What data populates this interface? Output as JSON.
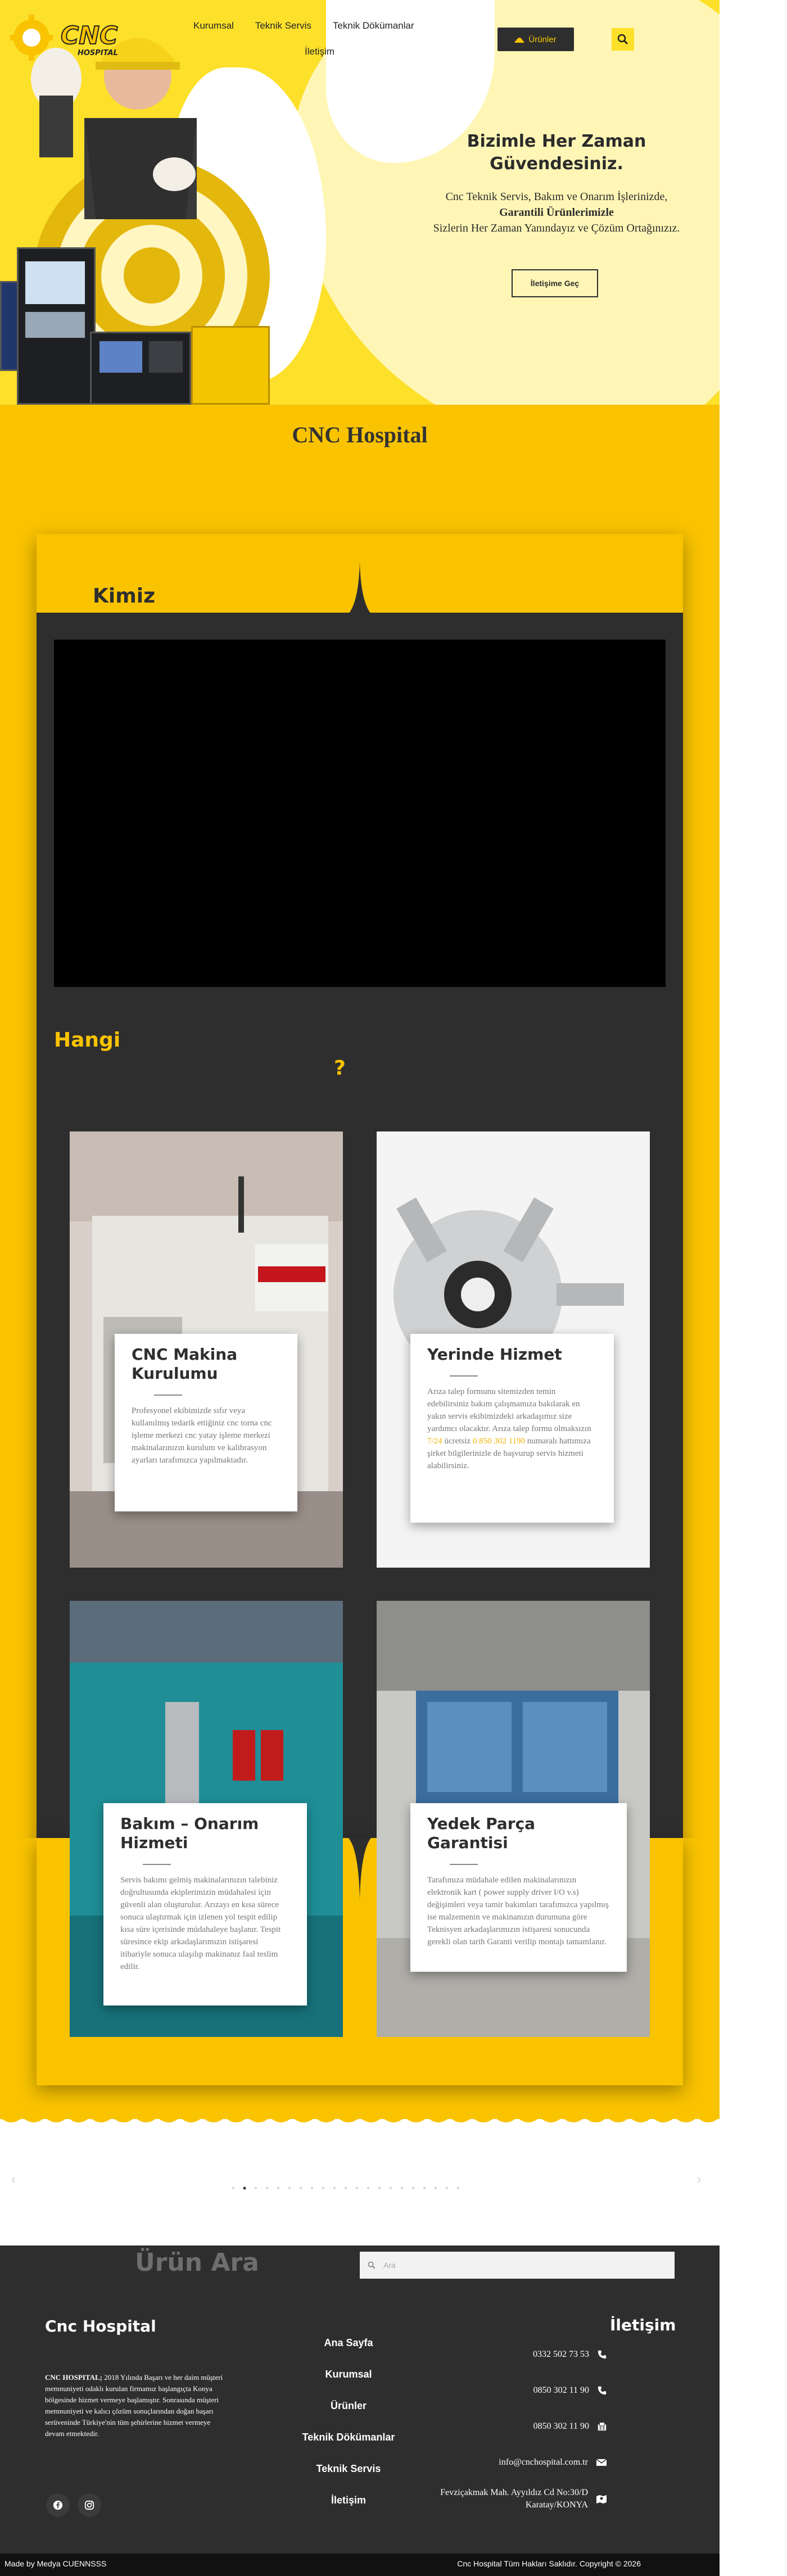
{
  "brand": {
    "logo_main": "CNC",
    "logo_sub": "HOSPITAL"
  },
  "nav": {
    "items": [
      "Kurumsal",
      "Teknik Servis",
      "Teknik Dökümanlar"
    ],
    "second_row": "İletişim",
    "products_button": "Ürünler"
  },
  "hero": {
    "title": "Bizimle Her Zaman Güvendesiniz.",
    "text_before": "Cnc Teknik Servis, Bakım ve Onarım İşlerinizde,",
    "text_bold": "Garantili Ürünlerimizle",
    "text_after": "Sizlerin Her Zaman Yanındayız ve Çözüm Ortağınızız.",
    "cta": "İletişime Geç"
  },
  "band": {
    "title": "CNC Hospital"
  },
  "about": {
    "heading": "Kimiz"
  },
  "services_heading": {
    "word": "Hangi",
    "qmark": "?"
  },
  "services": [
    {
      "title": "CNC Makina Kurulumu",
      "desc": "Profesyonel ekibimizde sıfır veya kullanılmış tedarik ettiğiniz cnc torna cnc işleme merkezi cnc yatay işleme merkezi makinalarınızın kurulum ve kalibrasyon ayarları tarafımızca yapılmaktadır."
    },
    {
      "title": "Yerinde Hizmet",
      "desc_1": "Arıza talep formunu sitemizden temin edebilirsiniz bakım çalışmamıza bakılarak en yakın servis ekibimizdeki arkadaşımız size yardımcı olacaktır. Arıza talep formu olmaksızın ",
      "desc_hl_1": "7/24",
      "desc_2": " ücretsiz ",
      "desc_hl_2": "0 850 302 1190",
      "desc_3": " numaralı hattımıza şirket bilgilerinizle de başvurup servis hizmeti alabilirsiniz."
    },
    {
      "title": "Bakım – Onarım Hizmeti",
      "desc": "Servis bakımı gelmiş makinalarınızın talebiniz doğrultusunda ekiplerimizin müdahalesi için güvenli alan oluşturulur. Arızayı en kısa sürece sonuca ulaştırmak için izlenen yol tespit edilip kısa süre içerisinde müdahaleye başlanır. Tespit süresince ekip arkadaşlarımızın istişaresi itibariyle sonuca ulaşılıp makinanız faal teslim edilir."
    },
    {
      "title": "Yedek Parça Garantisi",
      "desc": "Tarafımıza müdahale edilen makinalarınızın elektronik kart ( power supply driver I/O v.s) değişimleri veya tamir bakımları tarafımızca yapılmış ise malzemenin ve makinanızın durumuna göre Teknisyen arkadaşlarımızın istişaresi sonucunda gerekli olan tarih Garanti verilip montajı tamamlanır."
    }
  ],
  "footer": {
    "search_heading": "Ürün Ara",
    "search_placeholder": "Ara",
    "brand": "Cnc Hospital",
    "about_bold": "CNC HOSPITAL;",
    "about_text": " 2018 Yılında Başarı ve her daim müşteri memnuniyeti odaklı kurulan firmamız başlangıçta Konya bölgesinde hizmet vermeye başlamıştır. Sonrasında müşteri memnuniyeti ve kalıcı çözüm sonuçlarından doğan başarı serüveninde Türkiye'nin tüm şehirlerine hizmet vermeye devam etmektedir.",
    "links": [
      "Ana Sayfa",
      "Kurumsal",
      "Ürünler",
      "Teknik Dökümanlar",
      "Teknik Servis",
      "İletişim"
    ],
    "contact_title": "İletişim",
    "phone_1": "0332 502 73 53",
    "phone_2": "0850 302 11 90",
    "fax": "0850 302 11 90",
    "email": "info@cnchospital.com.tr",
    "address_1": "Fevziçakmak Mah. Ayyıldız Cd No:30/D",
    "address_2": "Karatay/KONYA",
    "made_by": "Made by Medya CUENNSSS",
    "copyright": "Cnc Hospital Tüm Hakları Saklıdır. Copyright © 2026"
  },
  "colors": {
    "accent": "#f9c300",
    "dark": "#2e2e2f",
    "hero_yellow": "#fde02a"
  }
}
